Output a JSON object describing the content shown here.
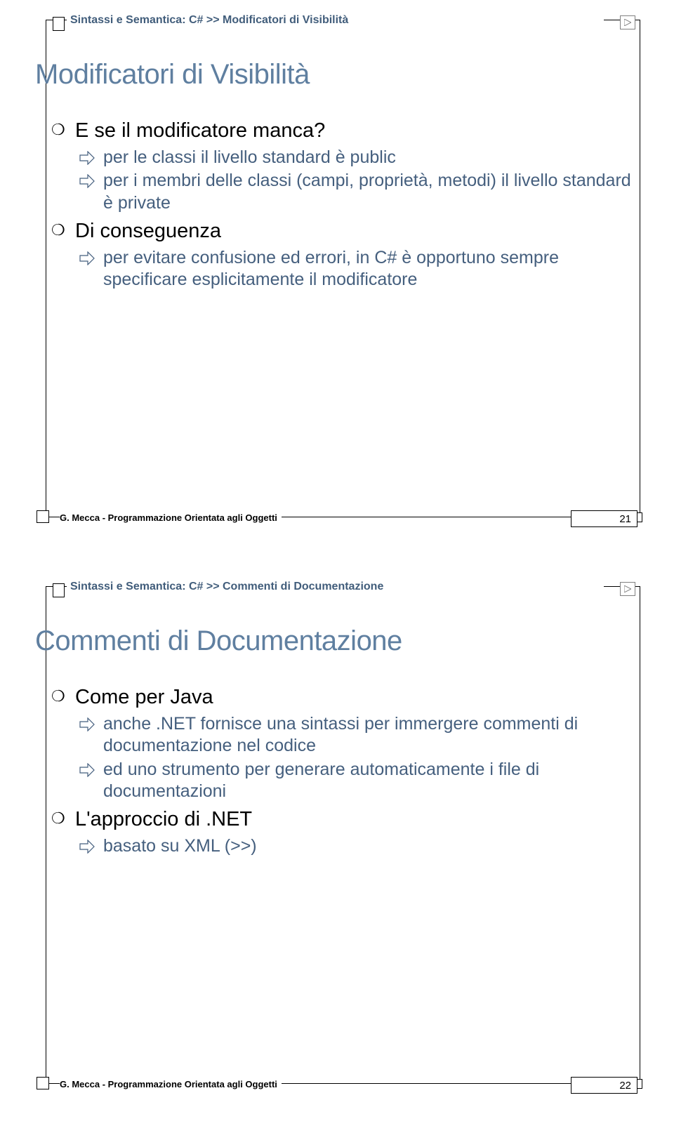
{
  "slide1": {
    "breadcrumb": "Sintassi e Semantica: C# >> Modificatori di Visibilità",
    "title": "Modificatori di Visibilità",
    "items": [
      {
        "level": 1,
        "text": "E se il modificatore manca?"
      },
      {
        "level": 2,
        "text": "per le classi il livello standard è public"
      },
      {
        "level": 2,
        "text": "per i membri delle classi (campi, proprietà, metodi) il livello standard è private"
      },
      {
        "level": 1,
        "text": "Di conseguenza"
      },
      {
        "level": 2,
        "text": "per evitare confusione ed errori, in C# è opportuno sempre specificare esplicitamente il modificatore"
      }
    ],
    "footer": "G. Mecca - Programmazione Orientata agli Oggetti",
    "page": "21"
  },
  "slide2": {
    "breadcrumb": "Sintassi e Semantica: C# >> Commenti di Documentazione",
    "title": "Commenti di Documentazione",
    "items": [
      {
        "level": 1,
        "text": "Come per Java"
      },
      {
        "level": 2,
        "text": "anche .NET fornisce una sintassi per immergere commenti di documentazione nel codice"
      },
      {
        "level": 2,
        "text": "ed uno strumento per generare automaticamente i file di documentazioni"
      },
      {
        "level": 1,
        "text": "L'approccio di .NET"
      },
      {
        "level": 2,
        "text": "basato su XML (>>)"
      }
    ],
    "footer": "G. Mecca - Programmazione Orientata agli Oggetti",
    "page": "22"
  }
}
